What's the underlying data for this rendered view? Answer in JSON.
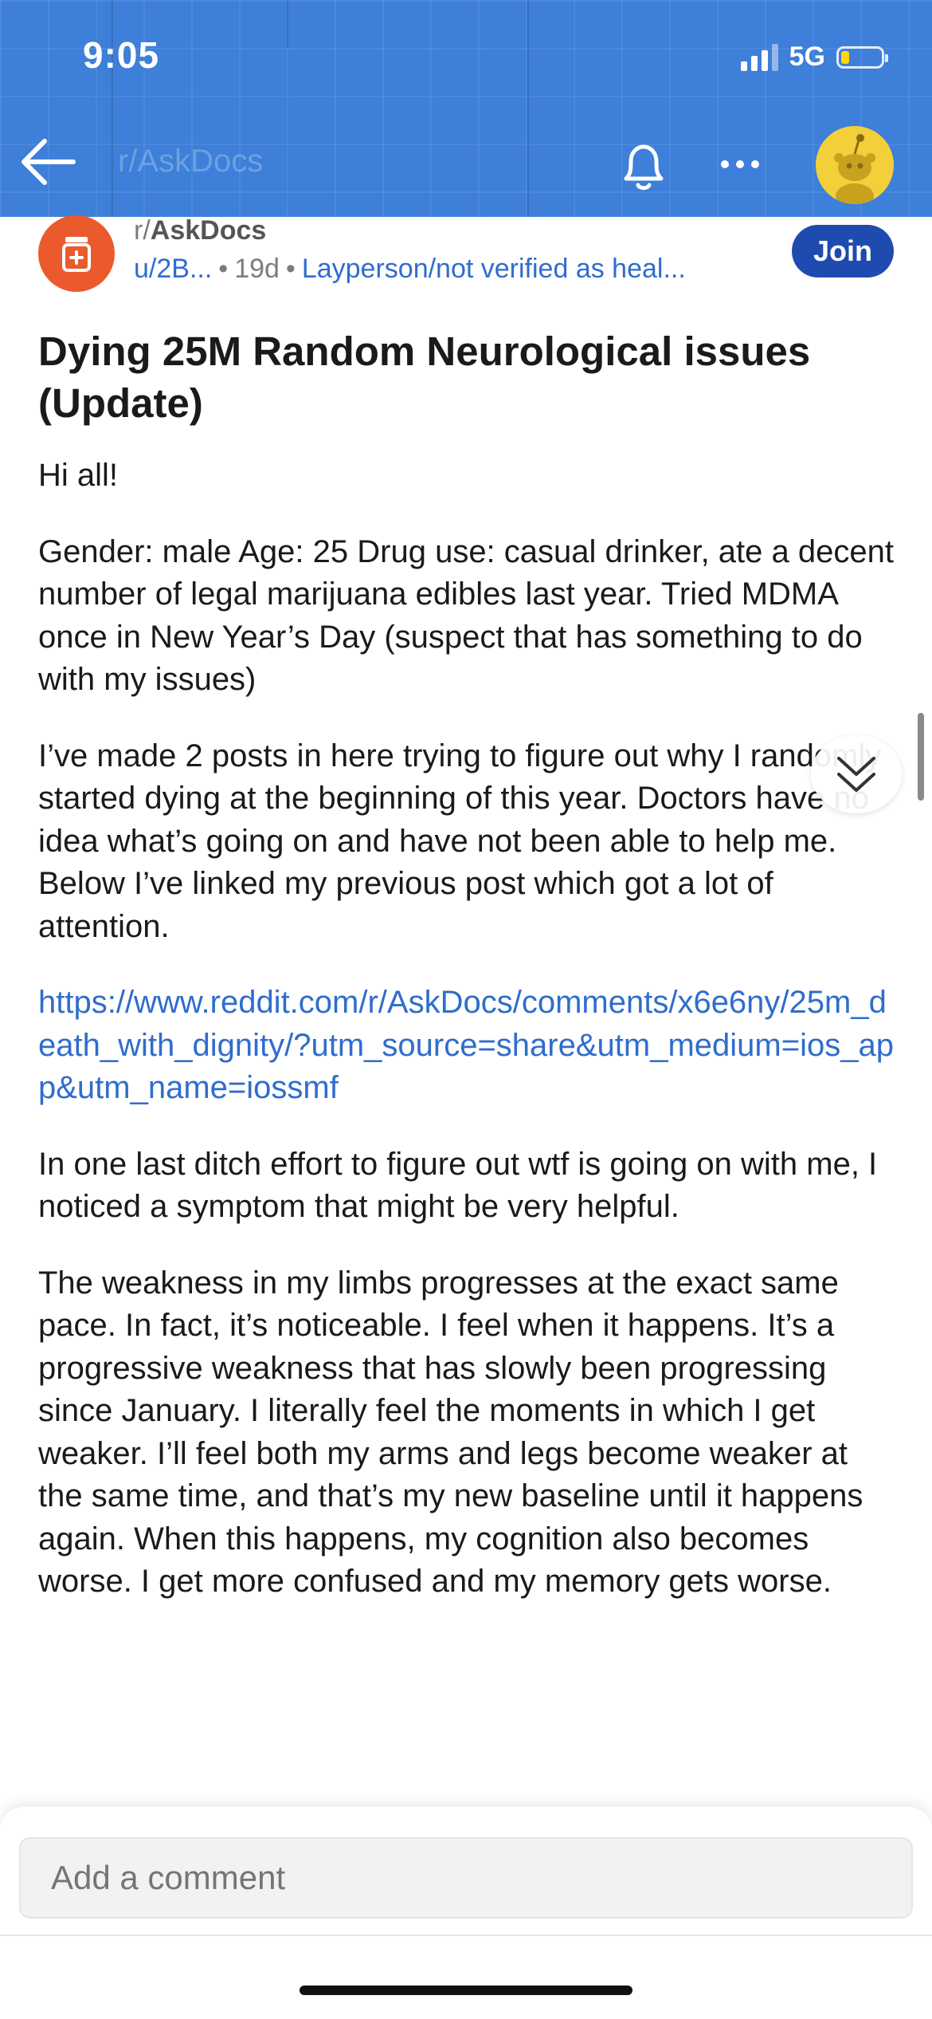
{
  "status_bar": {
    "time": "9:05",
    "network": "5G"
  },
  "header": {
    "subreddit": "r/AskDocs"
  },
  "post": {
    "subreddit_prefix": "r/",
    "subreddit_name": "AskDocs",
    "author": "u/2B...",
    "separator": "•",
    "age": "19d",
    "flair": "Layperson/not verified as heal...",
    "join_label": "Join",
    "title": "Dying 25M Random Neurological issues (Update)",
    "paragraphs": [
      "Hi all!",
      "Gender: male Age: 25 Drug use: casual drinker, ate a decent number of legal marijuana edibles last year. Tried MDMA once in New Year’s Day (suspect that has something to do with my issues)",
      "I’ve made 2 posts in here trying to figure out why I randomly started dying at the beginning of this year. Doctors have no idea what’s going on and have not been able to help me. Below I’ve linked my previous post which got a lot of attention."
    ],
    "link": "https://www.reddit.com/r/AskDocs/comments/x6e6ny/25m_death_with_dignity/?utm_source=share&utm_medium=ios_app&utm_name=iossmf",
    "paragraphs_after": [
      "In one last ditch effort to figure out wtf is going on with me, I noticed a symptom that might be very helpful.",
      "The weakness in my limbs progresses at the exact same pace. In fact, it’s noticeable. I feel when it happens. It’s a progressive weakness that has slowly been progressing since January. I literally feel the moments in which I get weaker. I’ll feel both my arms and legs become weaker at the same time, and that’s my new baseline until it happens again. When this happens, my cognition also becomes worse. I get more confused and my memory gets worse."
    ]
  },
  "comment": {
    "placeholder": "Add a comment"
  },
  "icons": [
    "back-arrow-icon",
    "bell-icon",
    "more-icon",
    "subreddit-icon",
    "chevron-double-down-icon",
    "signal-icon",
    "battery-icon"
  ],
  "colors": {
    "header_bg": "#3d7fd9",
    "accent": "#2f6dcc",
    "join_bg": "#1f4bb0",
    "subreddit_icon_bg": "#ea5a2c",
    "battery_fill": "#ffd60a"
  }
}
